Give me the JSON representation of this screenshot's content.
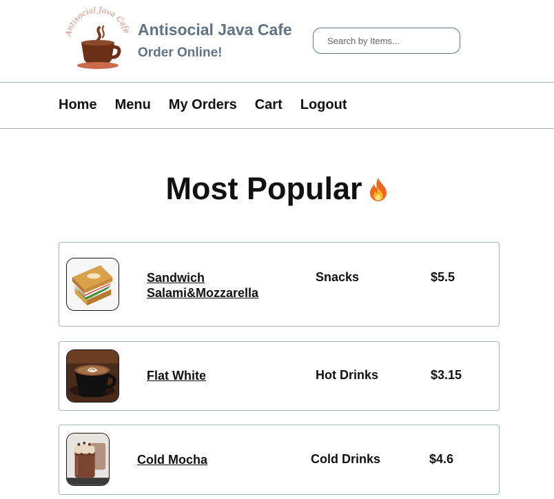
{
  "header": {
    "logo_text": "Antisocial Java Cafe",
    "title": "Antisocial Java Cafe",
    "subtitle": "Order Online!",
    "search_placeholder": "Search by Items..."
  },
  "nav": {
    "items": [
      "Home",
      "Menu",
      "My Orders",
      "Cart",
      "Logout"
    ]
  },
  "main": {
    "heading": "Most Popular",
    "heading_icon": "fire-icon",
    "items": [
      {
        "name": "Sandwich Salami&Mozzarella",
        "category": "Snacks",
        "price": "$5.5",
        "image": "sandwich-image"
      },
      {
        "name": "Flat White",
        "category": "Hot Drinks",
        "price": "$3.15",
        "image": "flat-white-image"
      },
      {
        "name": "Cold Mocha",
        "category": "Cold Drinks",
        "price": "$4.6",
        "image": "cold-mocha-image"
      }
    ]
  },
  "colors": {
    "brand": "#5f7384",
    "border": "#a9b3bc",
    "text": "#111111"
  }
}
